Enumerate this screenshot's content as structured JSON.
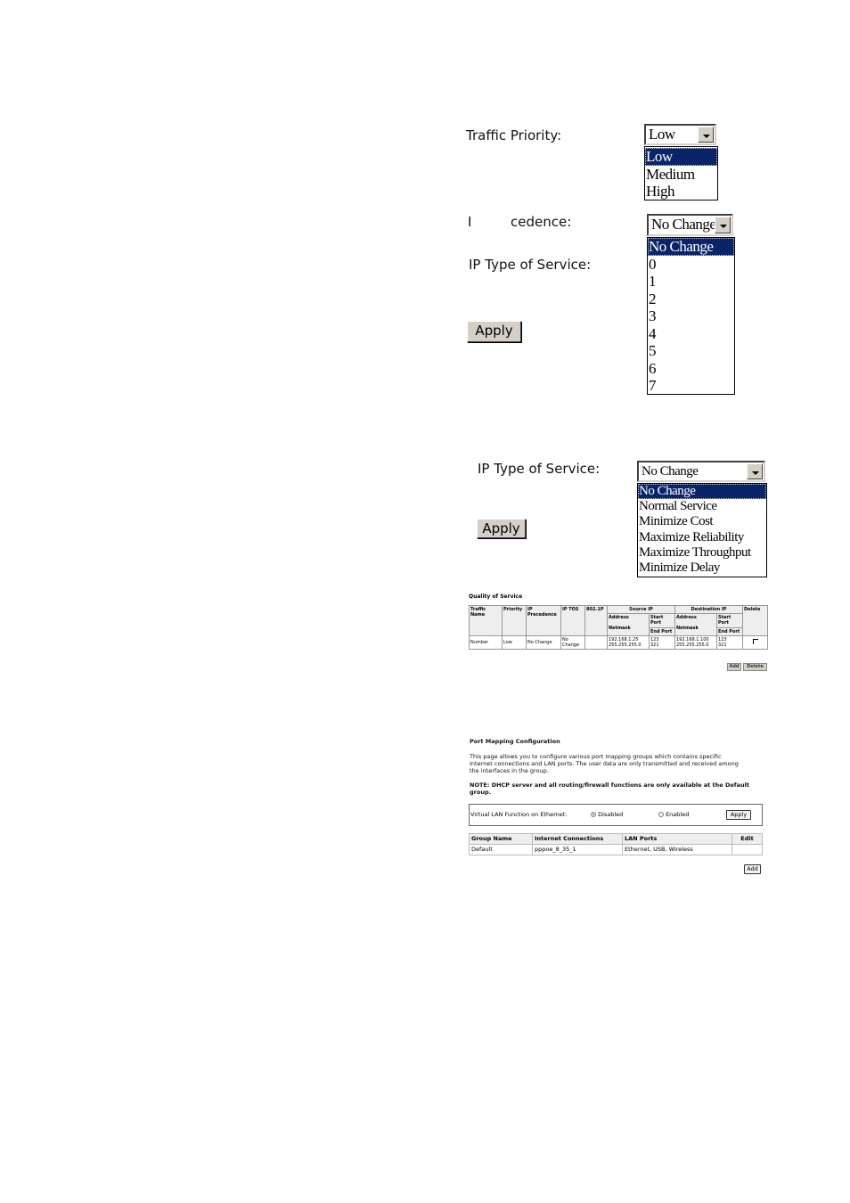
{
  "traffic_priority": {
    "label": "Traffic Priority:",
    "selected": "Low",
    "options": [
      "Low",
      "Medium",
      "High"
    ]
  },
  "ip_precedence_panel": {
    "precedence_label_start": "I",
    "precedence_label_end": "cedence:",
    "tos_label": "IP Type of Service:",
    "apply_label": "Apply",
    "selected": "No Change",
    "options": [
      "No Change",
      "0",
      "1",
      "2",
      "3",
      "4",
      "5",
      "6",
      "7"
    ]
  },
  "ip_tos_panel": {
    "label": "IP Type of Service:",
    "apply_label": "Apply",
    "selected": "No Change",
    "options": [
      "No Change",
      "Normal Service",
      "Minimize Cost",
      "Maximize Reliability",
      "Maximize Throughput",
      "Minimize Delay"
    ]
  },
  "qos": {
    "title": "Quality of Service",
    "headers": {
      "traffic_name": "Traffic Name",
      "priority": "Priority",
      "ip_precedence": "IP Precedence",
      "ip_tos": "IP TOS",
      "dot1p": "802.1P",
      "source_ip": "Source IP",
      "destination_ip": "Destination IP",
      "delete": "Delete",
      "address": "Address",
      "netmask": "Netmask",
      "start_port": "Start Port",
      "end_port": "End Port"
    },
    "rows": [
      {
        "traffic_name": "Number",
        "priority": "Low",
        "ip_precedence": "No Change",
        "ip_tos": "No Change",
        "dot1p": "",
        "src_address": "192.168.1.25",
        "src_netmask": "255.255.255.0",
        "src_start_port": "123",
        "src_end_port": "321",
        "dst_address": "192.168.1.100",
        "dst_netmask": "255.255.255.0",
        "dst_start_port": "123",
        "dst_end_port": "321"
      }
    ],
    "add_label": "Add",
    "delete_label": "Delete"
  },
  "port_mapping": {
    "title": "Port Mapping Configuration",
    "description": "This page allows you to configure various port mapping groups which contains specific Internet connections and LAN ports. The user data are only transmitted and received among the interfaces in the group.",
    "note": "NOTE: DHCP server and all routing/firewall functions are only available at the Default group.",
    "vlan_label": "Virtual LAN Function on Ethernet:",
    "disabled_label": "Disabled",
    "enabled_label": "Enabled",
    "vlan_state": "Disabled",
    "apply_label": "Apply",
    "headers": [
      "Group Name",
      "Internet Connections",
      "LAN Ports",
      "Edit"
    ],
    "rows": [
      {
        "group_name": "Default",
        "internet_connections": "pppoe_8_35_1",
        "lan_ports": "Ethernet, USB, Wireless",
        "edit": ""
      }
    ],
    "add_label": "Add"
  }
}
